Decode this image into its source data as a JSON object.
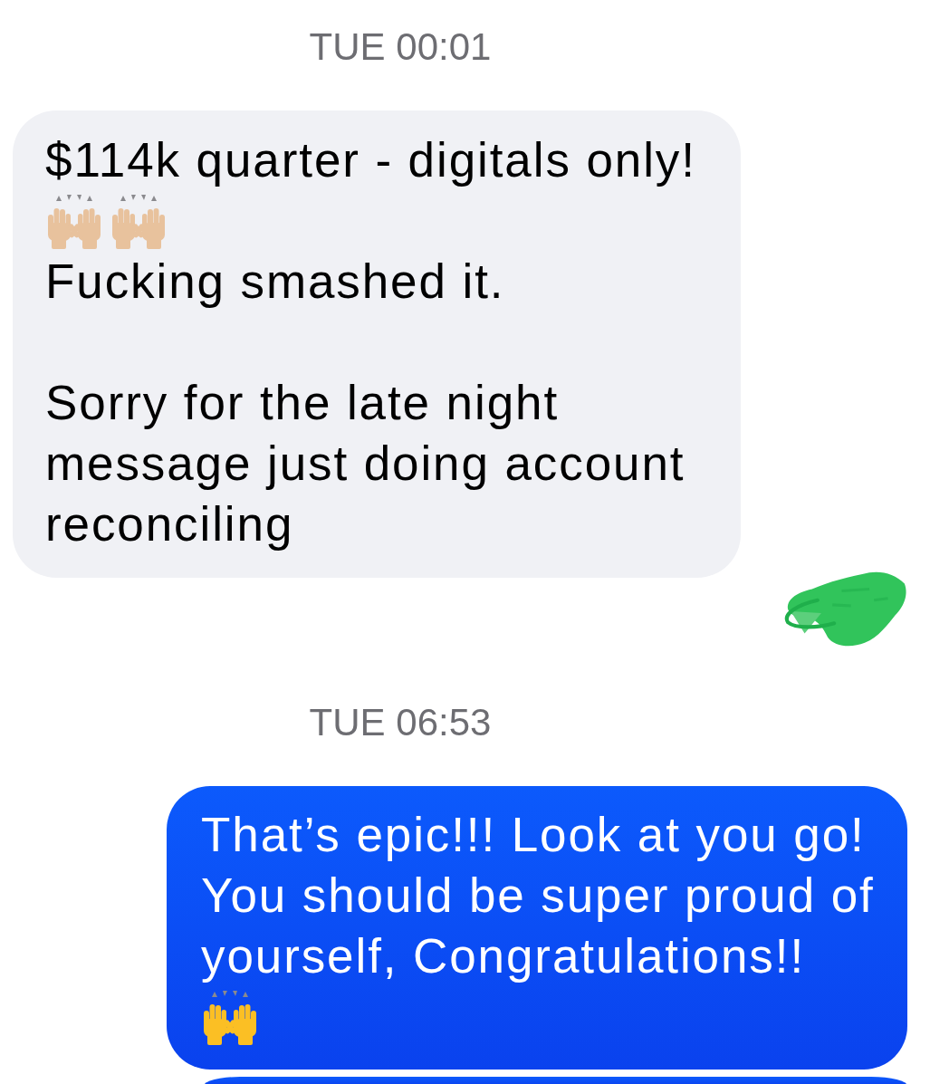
{
  "conversation": [
    {
      "kind": "timestamp",
      "text": "TUE 00:01"
    },
    {
      "kind": "message",
      "outgoing": false,
      "blocks": [
        {
          "kind": "text",
          "text": "$114k quarter - digitals only!"
        },
        {
          "kind": "emoji",
          "emojis": [
            {
              "color": "#e8c29d"
            },
            {
              "color": "#e8c29d"
            }
          ]
        },
        {
          "kind": "text",
          "text": "Fucking smashed it."
        },
        {
          "kind": "paragraph",
          "text": "Sorry for the late night message just doing account reconciling"
        }
      ]
    },
    {
      "kind": "redaction"
    },
    {
      "kind": "timestamp",
      "text": "TUE 06:53"
    },
    {
      "kind": "message",
      "outgoing": true,
      "blocks": [
        {
          "kind": "text",
          "text": "That’s epic!!! Look at you go! You should be super proud of yourself, Congratulations!!"
        },
        {
          "kind": "emoji",
          "emojis": [
            {
              "color": "#fbbf24"
            }
          ]
        }
      ]
    },
    {
      "kind": "message",
      "outgoing": true
    }
  ]
}
